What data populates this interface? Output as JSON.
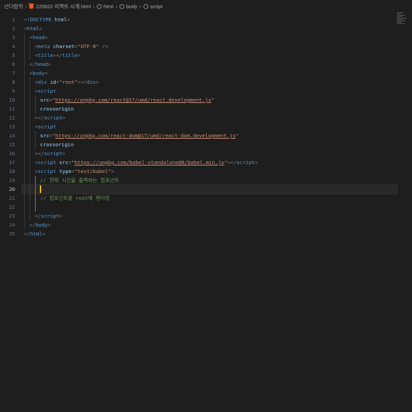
{
  "breadcrumb": {
    "items": [
      "넌다람쥐",
      "220622 리액트 시계.html",
      "html",
      "body",
      "script"
    ]
  },
  "editor": {
    "current_line": 20,
    "lines": [
      {
        "n": 1,
        "tokens": [
          [
            "punct",
            "<"
          ],
          [
            "tag",
            "!DOCTYPE"
          ],
          [
            "text",
            " "
          ],
          [
            "attr",
            "html"
          ],
          [
            "punct",
            ">"
          ]
        ]
      },
      {
        "n": 2,
        "tokens": [
          [
            "punct",
            "<"
          ],
          [
            "tag",
            "html"
          ],
          [
            "punct",
            ">"
          ]
        ]
      },
      {
        "n": 3,
        "tokens": [
          [
            "punct",
            "<"
          ],
          [
            "tag",
            "head"
          ],
          [
            "punct",
            ">"
          ]
        ]
      },
      {
        "n": 4,
        "tokens": [
          [
            "punct",
            "<"
          ],
          [
            "tag",
            "meta"
          ],
          [
            "text",
            " "
          ],
          [
            "attr",
            "charset"
          ],
          [
            "punct",
            "="
          ],
          [
            "str",
            "\"UTF-8\""
          ],
          [
            "text",
            " "
          ],
          [
            "punct",
            "/>"
          ]
        ]
      },
      {
        "n": 5,
        "tokens": [
          [
            "punct",
            "<"
          ],
          [
            "tag",
            "title"
          ],
          [
            "punct",
            "></"
          ],
          [
            "tag",
            "title"
          ],
          [
            "punct",
            ">"
          ]
        ]
      },
      {
        "n": 6,
        "tokens": [
          [
            "punct",
            "</"
          ],
          [
            "tag",
            "head"
          ],
          [
            "punct",
            ">"
          ]
        ]
      },
      {
        "n": 7,
        "tokens": [
          [
            "punct",
            "<"
          ],
          [
            "tag",
            "body"
          ],
          [
            "punct",
            ">"
          ]
        ]
      },
      {
        "n": 8,
        "tokens": [
          [
            "punct",
            "<"
          ],
          [
            "tag",
            "div"
          ],
          [
            "text",
            " "
          ],
          [
            "attr",
            "id"
          ],
          [
            "punct",
            "="
          ],
          [
            "str",
            "\"root\""
          ],
          [
            "punct",
            "></"
          ],
          [
            "tag",
            "div"
          ],
          [
            "punct",
            ">"
          ]
        ]
      },
      {
        "n": 9,
        "tokens": [
          [
            "punct",
            "<"
          ],
          [
            "tag",
            "script"
          ]
        ]
      },
      {
        "n": 10,
        "tokens": [
          [
            "attr",
            "src"
          ],
          [
            "punct",
            "="
          ],
          [
            "str",
            "\""
          ],
          [
            "url",
            "https://unpkg.com/react@17/umd/react.development.js"
          ],
          [
            "str",
            "\""
          ]
        ]
      },
      {
        "n": 11,
        "tokens": [
          [
            "attr",
            "crossorigin"
          ]
        ]
      },
      {
        "n": 12,
        "tokens": [
          [
            "punct",
            "></"
          ],
          [
            "tag",
            "script"
          ],
          [
            "punct",
            ">"
          ]
        ]
      },
      {
        "n": 13,
        "tokens": [
          [
            "punct",
            "<"
          ],
          [
            "tag",
            "script"
          ]
        ]
      },
      {
        "n": 14,
        "tokens": [
          [
            "attr",
            "src"
          ],
          [
            "punct",
            "="
          ],
          [
            "str",
            "\""
          ],
          [
            "url",
            "https://unpkg.com/react-dom@17/umd/react-dom.development.js"
          ],
          [
            "str",
            "\""
          ]
        ]
      },
      {
        "n": 15,
        "tokens": [
          [
            "attr",
            "crossorigin"
          ]
        ]
      },
      {
        "n": 16,
        "tokens": [
          [
            "punct",
            "></"
          ],
          [
            "tag",
            "script"
          ],
          [
            "punct",
            ">"
          ]
        ]
      },
      {
        "n": 17,
        "tokens": [
          [
            "punct",
            "<"
          ],
          [
            "tag",
            "script"
          ],
          [
            "text",
            " "
          ],
          [
            "attr",
            "src"
          ],
          [
            "punct",
            "="
          ],
          [
            "str",
            "\""
          ],
          [
            "url",
            "https://unpkg.com/babel-standalone@6/babel.min.js"
          ],
          [
            "str",
            "\""
          ],
          [
            "punct",
            "></"
          ],
          [
            "tag",
            "script"
          ],
          [
            "punct",
            ">"
          ]
        ]
      },
      {
        "n": 18,
        "tokens": [
          [
            "punct",
            "<"
          ],
          [
            "tag",
            "script"
          ],
          [
            "text",
            " "
          ],
          [
            "attr",
            "type"
          ],
          [
            "punct",
            "="
          ],
          [
            "str",
            "\"text/babel\""
          ],
          [
            "punct",
            ">"
          ]
        ]
      },
      {
        "n": 19,
        "tokens": [
          [
            "comment",
            "// 현재 시간을 출력하는 컴포넌트"
          ]
        ]
      },
      {
        "n": 20,
        "tokens": []
      },
      {
        "n": 21,
        "tokens": [
          [
            "comment",
            "// 컴포넌트를 root에 렌더링"
          ]
        ]
      },
      {
        "n": 22,
        "tokens": []
      },
      {
        "n": 23,
        "tokens": [
          [
            "punct",
            "</"
          ],
          [
            "tag",
            "script"
          ],
          [
            "punct",
            ">"
          ]
        ]
      },
      {
        "n": 24,
        "tokens": [
          [
            "punct",
            "</"
          ],
          [
            "tag",
            "body"
          ],
          [
            "punct",
            ">"
          ]
        ]
      },
      {
        "n": 25,
        "tokens": [
          [
            "punct",
            "</"
          ],
          [
            "tag",
            "html"
          ],
          [
            "punct",
            ">"
          ]
        ]
      }
    ]
  },
  "colors": {
    "background": "#1e1e1e",
    "cursor": "#f0c000",
    "comment": "#6a9955",
    "tag": "#569cd6",
    "attr": "#9cdcfe",
    "string": "#ce9178"
  }
}
